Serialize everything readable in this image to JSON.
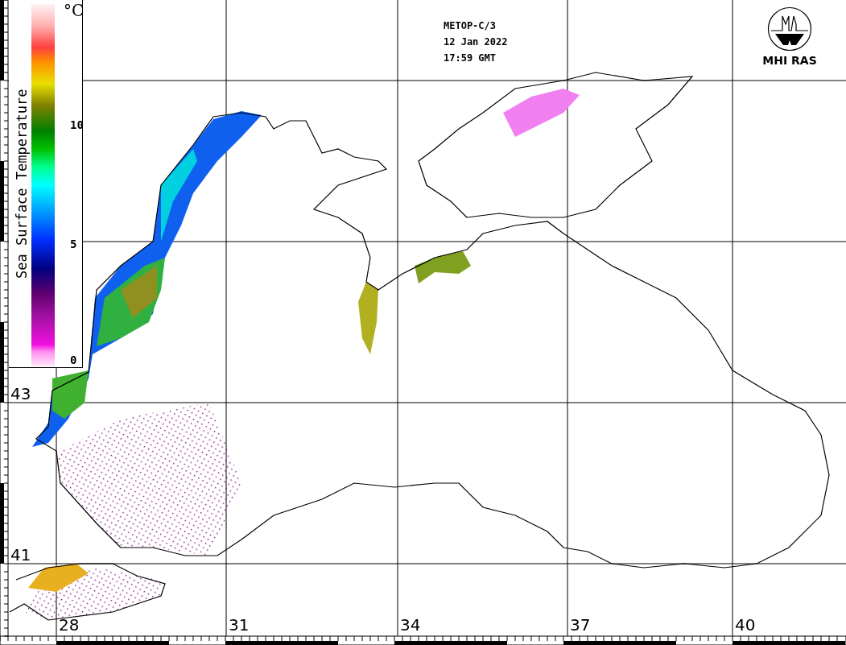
{
  "header": {
    "satellite": "METOP-C/3",
    "date": "12 Jan 2022",
    "time": "17:59 GMT"
  },
  "logo": {
    "text": "MHI RAS"
  },
  "color_scale": {
    "title": "Sea Surface Temperature",
    "unit": "°C",
    "tick_labels": [
      "10",
      "5",
      "0"
    ]
  },
  "latitude_labels": [
    "43",
    "41"
  ],
  "longitude_labels": [
    "28",
    "31",
    "34",
    "37",
    "40"
  ]
}
